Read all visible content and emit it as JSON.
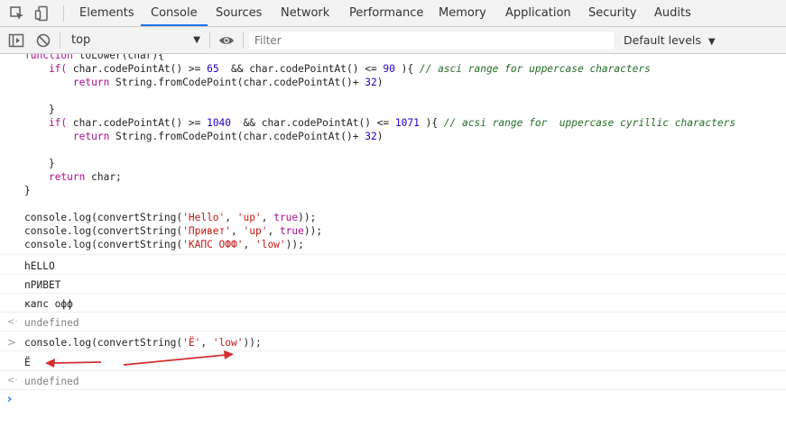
{
  "tabs": [
    {
      "label": "Elements"
    },
    {
      "label": "Console",
      "active": true
    },
    {
      "label": "Sources"
    },
    {
      "label": "Network"
    },
    {
      "label": "Performance"
    },
    {
      "label": "Memory"
    },
    {
      "label": "Application"
    },
    {
      "label": "Security"
    },
    {
      "label": "Audits"
    }
  ],
  "toolbar": {
    "context": "top",
    "filter_placeholder": "Filter",
    "levels": "Default levels"
  },
  "code": {
    "l1a": "function",
    "l1b": " toLower(char){",
    "l2a": "    if(",
    "l2b": " char.codePointAt() >= ",
    "l2c": "65",
    "l2d": "  && char.codePointAt() <= ",
    "l2e": "90",
    "l2f": " ){ ",
    "l2g": "// asci range for uppercase characters",
    "l3a": "        ",
    "l3b": "return",
    "l3c": " String.fromCodePoint(char.codePointAt()+ ",
    "l3d": "32",
    "l3e": ")",
    "l4": "    }",
    "l5a": "    if(",
    "l5b": " char.codePointAt() >= ",
    "l5c": "1040",
    "l5d": "  && char.codePointAt() <= ",
    "l5e": "1071",
    "l5f": " ){ ",
    "l5g": "// acsi range for  uppercase cyrillic characters",
    "l6a": "        ",
    "l6b": "return",
    "l6c": " String.fromCodePoint(char.codePointAt()+ ",
    "l6d": "32",
    "l6e": ")",
    "l7": "    }",
    "l8a": "    ",
    "l8b": "return",
    "l8c": " char;",
    "l9": "}",
    "c1a": "console.log(convertString(",
    "c1b": "'Hello'",
    "c1c": ", ",
    "c1d": "'up'",
    "c1e": ", ",
    "c1f": "true",
    "c1g": "));",
    "c2a": "console.log(convertString(",
    "c2b": "'Привет'",
    "c2c": ", ",
    "c2d": "'up'",
    "c2e": ", ",
    "c2f": "true",
    "c2g": "));",
    "c3a": "console.log(convertString(",
    "c3b": "'КАПС ОФФ'",
    "c3c": ", ",
    "c3d": "'low'",
    "c3e": "));"
  },
  "output": {
    "o1": "hELLO",
    "o2": "пРИВЕТ",
    "o3": "капс офф",
    "o4": "undefined",
    "cmd_a": "console.log(convertString(",
    "cmd_b": "'Ё'",
    "cmd_c": ", ",
    "cmd_d": "'low'",
    "cmd_e": "));",
    "o5": "Ё",
    "o6": "undefined"
  },
  "colors": {
    "annotation_arrow": "#d32f2f",
    "active_tab_underline": "#1a73e8"
  }
}
